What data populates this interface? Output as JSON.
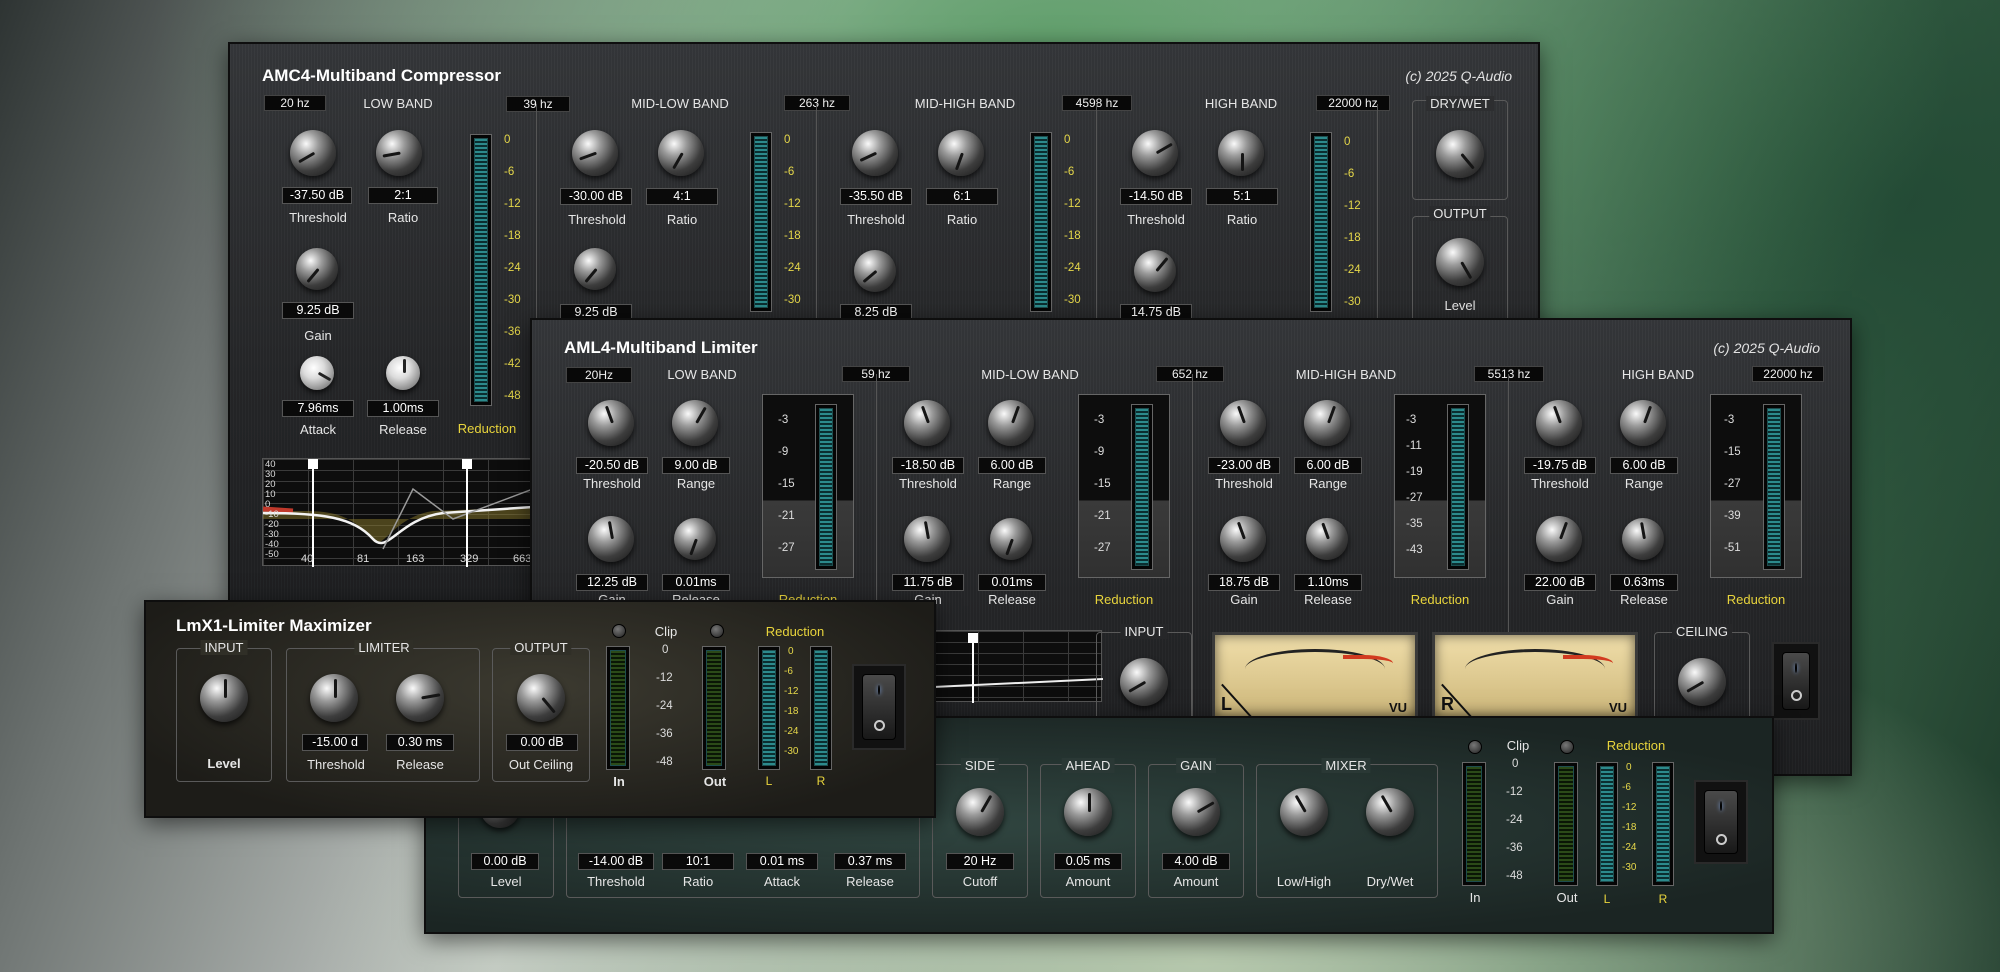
{
  "amc4": {
    "title": "AMC4-Multiband Compressor",
    "copyright": "(c) 2025 Q-Audio",
    "freqs": [
      "20 hz",
      "39 hz",
      "263 hz",
      "4598 hz",
      "22000 hz"
    ],
    "bands": [
      {
        "name": "LOW BAND",
        "threshold": "-37.50 dB",
        "ratio": "2:1",
        "gain": "9.25 dB",
        "attack": "7.96ms",
        "release": "1.00ms"
      },
      {
        "name": "MID-LOW BAND",
        "threshold": "-30.00 dB",
        "ratio": "4:1",
        "gain": "9.25 dB"
      },
      {
        "name": "MID-HIGH BAND",
        "threshold": "-35.50 dB",
        "ratio": "6:1",
        "gain": "8.25 dB"
      },
      {
        "name": "HIGH BAND",
        "threshold": "-14.50 dB",
        "ratio": "5:1",
        "gain": "14.75 dB"
      }
    ],
    "labels": {
      "threshold": "Threshold",
      "ratio": "Ratio",
      "gain": "Gain",
      "attack": "Attack",
      "release": "Release",
      "reduction": "Reduction",
      "drywet": "DRY/WET",
      "output": "OUTPUT",
      "level": "Level"
    },
    "meter_scale": [
      "0",
      "-6",
      "-12",
      "-18",
      "-24",
      "-30",
      "-36",
      "-42",
      "-48"
    ],
    "graph_y": [
      "40",
      "30",
      "20",
      "10",
      "0",
      "-10",
      "-20",
      "-30",
      "-40",
      "-50"
    ],
    "graph_x": [
      "40",
      "81",
      "163",
      "329",
      "663"
    ]
  },
  "aml4": {
    "title": "AML4-Multiband Limiter",
    "copyright": "(c) 2025 Q-Audio",
    "freqs": [
      "20Hz",
      "59 hz",
      "652 hz",
      "5513 hz",
      "22000 hz"
    ],
    "bands": [
      {
        "name": "LOW BAND",
        "threshold": "-20.50 dB",
        "range": "9.00 dB",
        "gain": "12.25 dB",
        "release": "0.01ms",
        "scale": [
          "-3",
          "-9",
          "-15",
          "-21",
          "-27"
        ]
      },
      {
        "name": "MID-LOW BAND",
        "threshold": "-18.50 dB",
        "range": "6.00 dB",
        "gain": "11.75 dB",
        "release": "0.01ms",
        "scale": [
          "-3",
          "-9",
          "-15",
          "-21",
          "-27"
        ]
      },
      {
        "name": "MID-HIGH BAND",
        "threshold": "-23.00 dB",
        "range": "6.00 dB",
        "gain": "18.75 dB",
        "release": "1.10ms",
        "scale": [
          "-3",
          "-11",
          "-19",
          "-27",
          "-35",
          "-43"
        ]
      },
      {
        "name": "HIGH BAND",
        "threshold": "-19.75 dB",
        "range": "6.00 dB",
        "gain": "22.00 dB",
        "release": "0.63ms",
        "scale": [
          "-3",
          "-15",
          "-27",
          "-39",
          "-51"
        ]
      }
    ],
    "labels": {
      "threshold": "Threshold",
      "range": "Range",
      "gain": "Gain",
      "release": "Release",
      "reduction": "Reduction",
      "input": "INPUT",
      "ceiling": "CEILING",
      "vu": "VU",
      "left": "L",
      "right": "R"
    },
    "vu_scale": [
      "20",
      "10",
      "7",
      "5",
      "3",
      "2",
      "1",
      "0",
      "1",
      "2",
      "3"
    ]
  },
  "lmx1": {
    "title": "LmX1-Limiter Maximizer",
    "labels": {
      "input": "INPUT",
      "limiter": "LIMITER",
      "output": "OUTPUT",
      "level": "Level",
      "threshold": "Threshold",
      "release": "Release",
      "out_ceiling": "Out Ceiling",
      "clip": "Clip",
      "reduction": "Reduction",
      "in": "In",
      "out": "Out",
      "left": "L",
      "right": "R"
    },
    "values": {
      "threshold": "-15.00 d",
      "release": "0.30 ms",
      "out_ceiling": "0.00 dB"
    },
    "clip_scale": [
      "0",
      "-12",
      "-24",
      "-36",
      "-48"
    ],
    "red_scale": [
      "0",
      "-6",
      "-12",
      "-18",
      "-24",
      "-30"
    ]
  },
  "fourth": {
    "labels": {
      "side": "SIDE",
      "ahead": "AHEAD",
      "gain": "GAIN",
      "mixer": "MIXER",
      "level": "Level",
      "threshold": "Threshold",
      "ratio": "Ratio",
      "attack": "Attack",
      "release": "Release",
      "cutoff": "Cutoff",
      "amount": "Amount",
      "lowhigh": "Low/High",
      "drywet": "Dry/Wet",
      "clip": "Clip",
      "reduction": "Reduction",
      "in": "In",
      "out": "Out",
      "left": "L",
      "right": "R"
    },
    "values": {
      "level": "0.00 dB",
      "threshold": "-14.00 dB",
      "ratio": "10:1",
      "attack": "0.01 ms",
      "release": "0.37 ms",
      "cutoff": "20 Hz",
      "ahead": "0.05 ms",
      "gain": "4.00 dB"
    },
    "clip_scale": [
      "0",
      "-12",
      "-24",
      "-36",
      "-48"
    ],
    "red_scale": [
      "0",
      "-6",
      "-12",
      "-18",
      "-24",
      "-30"
    ]
  }
}
